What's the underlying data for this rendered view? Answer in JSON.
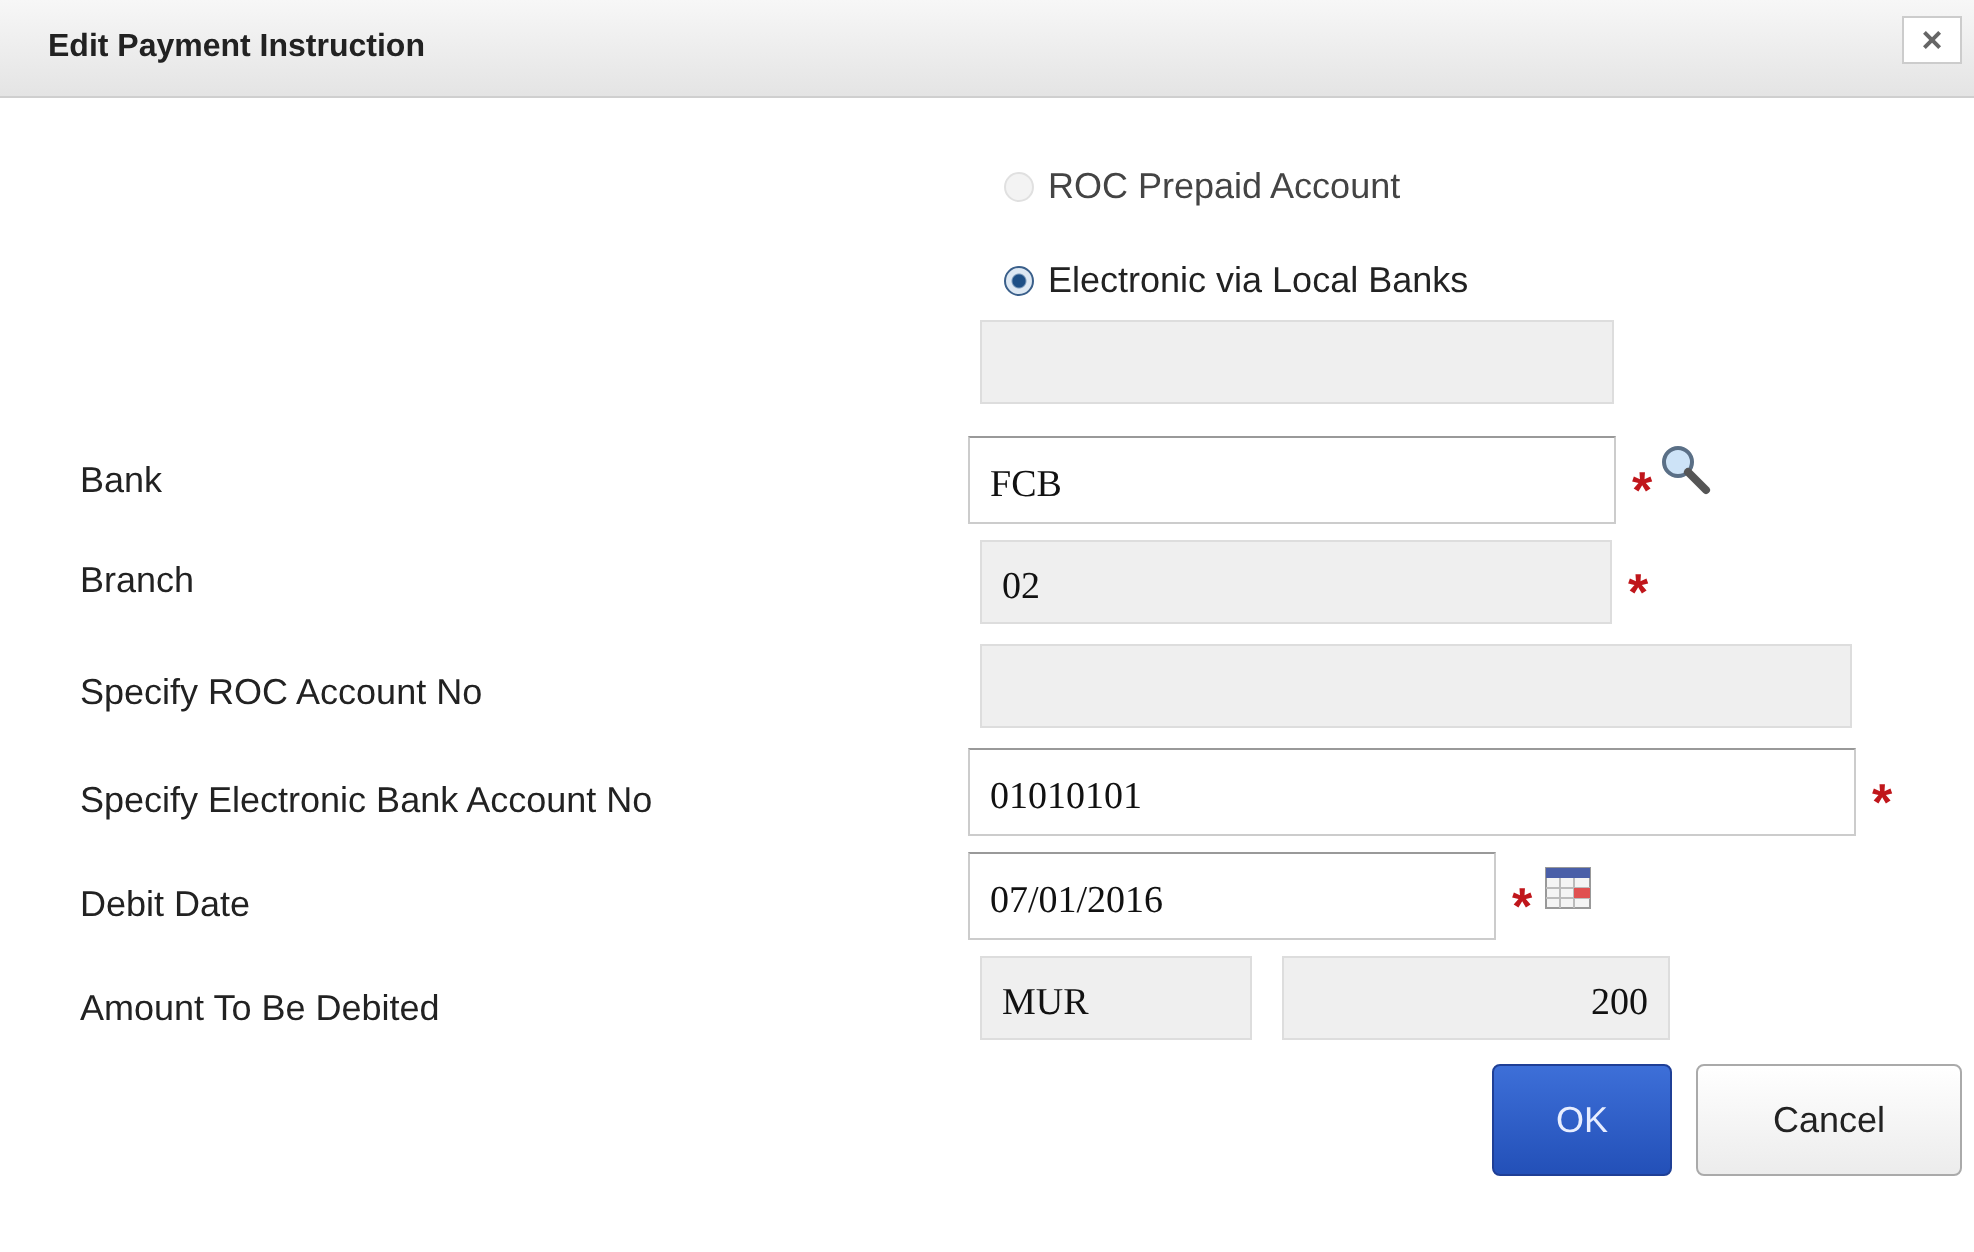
{
  "dialog": {
    "title": "Edit Payment Instruction",
    "close": "×"
  },
  "payment_options": [
    {
      "label": "ROC Prepaid Account",
      "selected": false,
      "disabled": true
    },
    {
      "label": "Electronic via Local Banks",
      "selected": true,
      "disabled": false
    }
  ],
  "fields": [
    {
      "label": "Bank",
      "value": "FCB",
      "readonly": false,
      "required": true,
      "kind": "lookup"
    },
    {
      "label": "Branch",
      "value": "02",
      "readonly": true,
      "required": true,
      "kind": "plain"
    },
    {
      "label": "Specify ROC Account No",
      "readonly": true,
      "required": false,
      "kind": "plain"
    },
    {
      "label": "Specify Electronic Bank Account No",
      "value": "01010101",
      "readonly": false,
      "required": true,
      "kind": "plain"
    },
    {
      "label": "Debit Date",
      "value": "07/01/2016",
      "readonly": false,
      "required": true,
      "kind": "date"
    },
    {
      "label": "Amount To Be Debited",
      "currency": "MUR",
      "value": "200",
      "readonly": true,
      "required": false,
      "kind": "amount"
    }
  ],
  "required_mark": "*",
  "buttons": [
    {
      "label": "OK",
      "kind": "primary"
    },
    {
      "label": "Cancel",
      "kind": "secondary"
    }
  ]
}
